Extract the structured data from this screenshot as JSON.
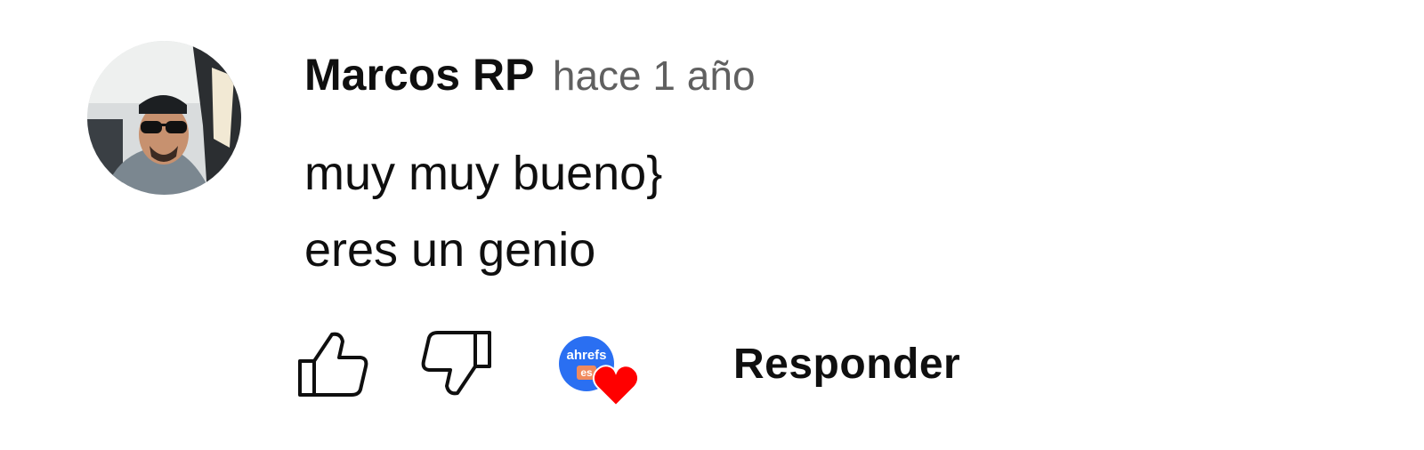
{
  "comment": {
    "author": "Marcos RP",
    "timestamp": "hace 1 año",
    "lines": [
      "muy muy bueno}",
      "eres un genio"
    ]
  },
  "creator_heart": {
    "brand": "ahrefs",
    "tag": "es",
    "heart_color": "#ff0000",
    "avatar_color": "#2a6ff2"
  },
  "actions": {
    "like_icon": "thumb-up-icon",
    "dislike_icon": "thumb-down-icon",
    "reply_label": "Responder"
  },
  "colors": {
    "text": "#0f0f0f",
    "secondary_text": "#606060"
  }
}
